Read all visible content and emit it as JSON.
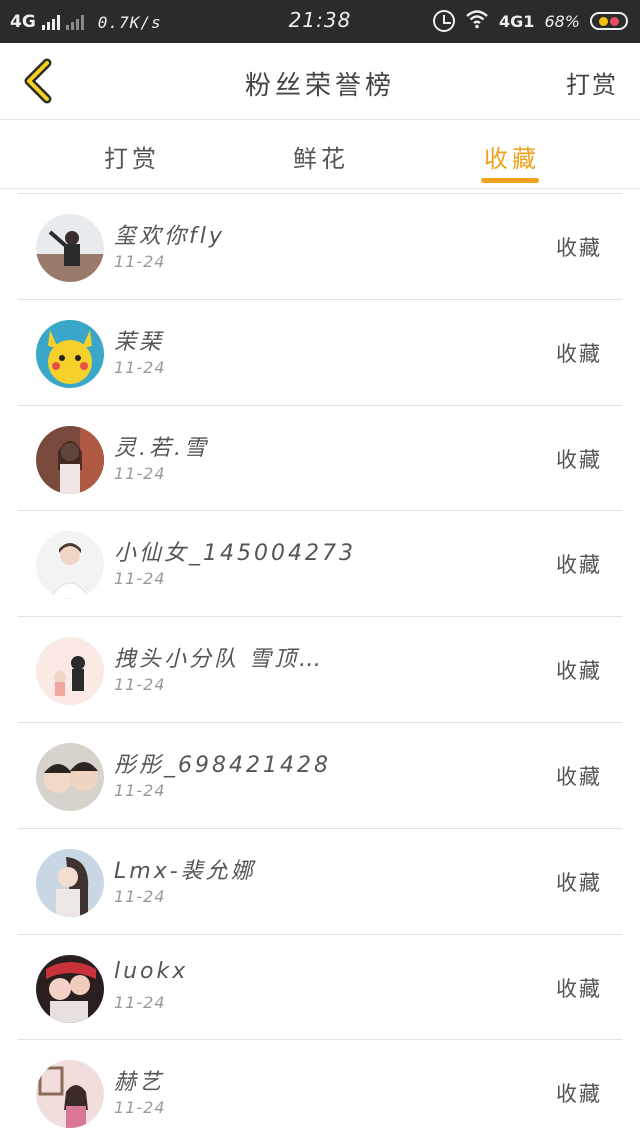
{
  "status_bar": {
    "network_left": "4G",
    "speed": "0.7K/s",
    "time": "21:38",
    "network_right": "4G1",
    "battery": "68%"
  },
  "header": {
    "title": "粉丝荣誉榜",
    "action": "打赏"
  },
  "tabs": [
    {
      "label": "打赏",
      "active": false
    },
    {
      "label": "鲜花",
      "active": false
    },
    {
      "label": "收藏",
      "active": true
    }
  ],
  "accent_color": "#f0a21c",
  "list": [
    {
      "name": "玺欢你fly",
      "date": "11-24",
      "action": "收藏"
    },
    {
      "name": "茉琹",
      "date": "11-24",
      "action": "收藏"
    },
    {
      "name": "灵.若.雪",
      "date": "11-24",
      "action": "收藏"
    },
    {
      "name": "小仙女_145004273",
      "date": "11-24",
      "action": "收藏"
    },
    {
      "name": "拽头小分队 雪顶…",
      "date": "11-24",
      "action": "收藏"
    },
    {
      "name": "彤彤_698421428",
      "date": "11-24",
      "action": "收藏"
    },
    {
      "name": "Lmx-裴允娜",
      "date": "11-24",
      "action": "收藏"
    },
    {
      "name": "luokx",
      "date": "11-24",
      "action": "收藏"
    },
    {
      "name": "赫艺",
      "date": "11-24",
      "action": "收藏"
    }
  ]
}
